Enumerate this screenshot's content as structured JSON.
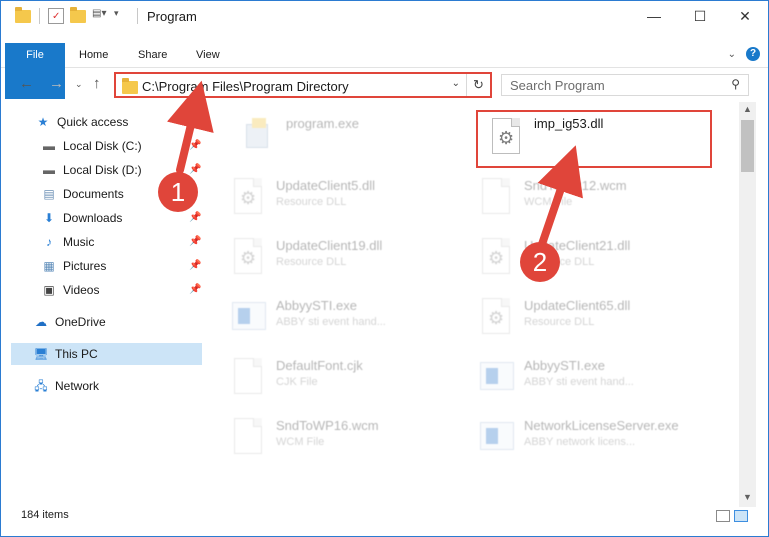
{
  "window": {
    "title": "Program"
  },
  "ribbon": {
    "tabs": [
      "File",
      "Home",
      "Share",
      "View"
    ]
  },
  "address": {
    "path": "C:\\Program Files\\Program Directory"
  },
  "search": {
    "placeholder": "Search Program"
  },
  "sidebar": {
    "items": [
      {
        "label": "Quick access",
        "icon": "star-icon"
      },
      {
        "label": "Local Disk (C:)",
        "icon": "drive-icon"
      },
      {
        "label": "Local Disk (D:)",
        "icon": "drive-icon"
      },
      {
        "label": "Documents",
        "icon": "documents-icon"
      },
      {
        "label": "Downloads",
        "icon": "download-icon"
      },
      {
        "label": "Music",
        "icon": "music-icon"
      },
      {
        "label": "Pictures",
        "icon": "pictures-icon"
      },
      {
        "label": "Videos",
        "icon": "videos-icon"
      },
      {
        "label": "OneDrive",
        "icon": "cloud-icon"
      },
      {
        "label": "This PC",
        "icon": "computer-icon"
      },
      {
        "label": "Network",
        "icon": "network-icon"
      }
    ]
  },
  "files": [
    {
      "name": "program.exe",
      "sub": ""
    },
    {
      "name": "imp_ig53.dll",
      "sub": ""
    },
    {
      "name": "UpdateClient5.dll",
      "sub": "Resource DLL"
    },
    {
      "name": "SndToWP12.wcm",
      "sub": "WCM File"
    },
    {
      "name": "UpdateClient19.dll",
      "sub": "Resource DLL"
    },
    {
      "name": "UpdateClient21.dll",
      "sub": "Resource DLL"
    },
    {
      "name": "AbbyySTI.exe",
      "sub": "ABBY sti event hand..."
    },
    {
      "name": "UpdateClient65.dll",
      "sub": "Resource DLL"
    },
    {
      "name": "DefaultFont.cjk",
      "sub": "CJK File"
    },
    {
      "name": "AbbyySTI.exe",
      "sub": "ABBY sti event hand..."
    },
    {
      "name": "SndToWP16.wcm",
      "sub": "WCM File"
    },
    {
      "name": "NetworkLicenseServer.exe",
      "sub": "ABBY network licens..."
    }
  ],
  "status": {
    "count": "184 items"
  },
  "annotations": {
    "marker1": "1",
    "marker2": "2",
    "color": "#e0453a"
  }
}
